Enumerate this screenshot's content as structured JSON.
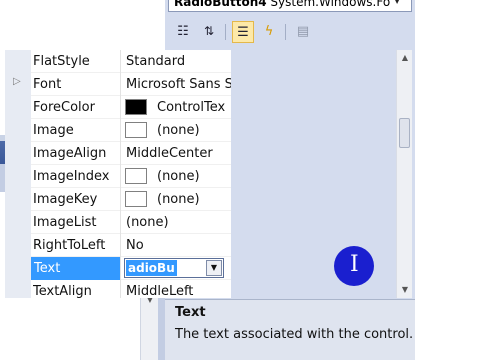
{
  "properties_window": {
    "selector": {
      "name": "RadioButton4",
      "type": "System.Windows.Fo"
    },
    "toolbar": {
      "categorized_icon": "categorized-icon",
      "alphabetical_icon": "alphabetical-icon",
      "properties_icon": "properties-icon",
      "events_icon": "events-icon",
      "property_pages_icon": "property-pages-icon"
    },
    "rows": [
      {
        "name": "FlatStyle",
        "value": "Standard"
      },
      {
        "name": "Font",
        "value": "Microsoft Sans S"
      },
      {
        "name": "ForeColor",
        "value": "ControlTex"
      },
      {
        "name": "Image",
        "value": "(none)"
      },
      {
        "name": "ImageAlign",
        "value": "MiddleCenter"
      },
      {
        "name": "ImageIndex",
        "value": "(none)"
      },
      {
        "name": "ImageKey",
        "value": "(none)"
      },
      {
        "name": "ImageList",
        "value": "(none)"
      },
      {
        "name": "RightToLeft",
        "value": "No"
      },
      {
        "name": "Text",
        "value": "adioBu"
      },
      {
        "name": "TextAlign",
        "value": "MiddleLeft"
      }
    ],
    "description": {
      "title": "Text",
      "text": "The text associated with the control."
    }
  },
  "dock_panel": {
    "controls": {
      "dropdown": "▾",
      "pin": "📌",
      "close": "✕"
    }
  },
  "colors": {
    "accent_selected": "#3399ff",
    "dock_header": "#3b5898",
    "panel_background": "#d4dcee"
  }
}
